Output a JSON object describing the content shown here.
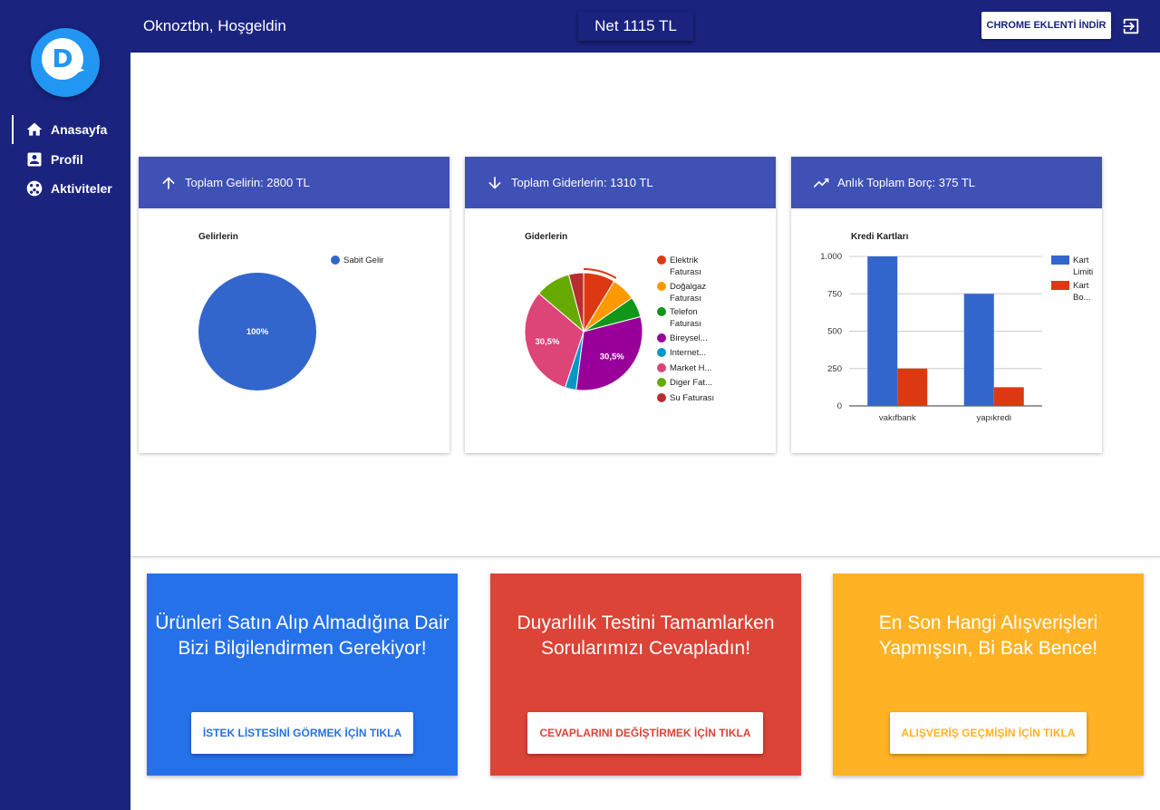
{
  "sidebar": {
    "logo_letter": "D",
    "items": [
      {
        "label": "Anasayfa",
        "icon": "home-icon",
        "active": true
      },
      {
        "label": "Profil",
        "icon": "profile-icon",
        "active": false
      },
      {
        "label": "Aktiviteler",
        "icon": "activities-icon",
        "active": false
      }
    ]
  },
  "header": {
    "welcome": "Oknoztbn, Hoşgeldin",
    "net": "Net 1115 TL",
    "chrome_button": "CHROME EKLENTİ İNDİR",
    "logout_icon": "logout-icon"
  },
  "colors": {
    "navy": "#1a237e",
    "card_header": "#3f51b5",
    "blue": "#2571e9",
    "red": "#db4437",
    "yellow": "#ffb224"
  },
  "cards": [
    {
      "title": "Toplam Gelirin: 2800 TL",
      "icon": "arrow-up-icon"
    },
    {
      "title": "Toplam Giderlerin: 1310 TL",
      "icon": "arrow-down-icon"
    },
    {
      "title": "Anlık Toplam Borç: 375 TL",
      "icon": "trending-up-icon"
    }
  ],
  "chart_data": [
    {
      "type": "pie",
      "title": "Gelirlerin",
      "slices": [
        {
          "label": "Sabit Gelir",
          "value": 100,
          "color": "#3366cc",
          "display": "100%"
        }
      ]
    },
    {
      "type": "pie",
      "title": "Giderlerin",
      "slices": [
        {
          "label": "Elektrik Faturası",
          "lines": [
            "Elektrik",
            "Faturası"
          ],
          "value": 8.5,
          "color": "#dc3912"
        },
        {
          "label": "Doğalgaz Faturası",
          "lines": [
            "Doğalgaz",
            "Faturası"
          ],
          "value": 6.5,
          "color": "#ff9900"
        },
        {
          "label": "Telefon Faturası",
          "lines": [
            "Telefon",
            "Faturası"
          ],
          "value": 5.5,
          "color": "#109618"
        },
        {
          "label": "Bireysel...",
          "lines": [
            "Bireysel..."
          ],
          "value": 30.5,
          "color": "#990099",
          "display": "30,5%"
        },
        {
          "label": "Internet...",
          "lines": [
            "Internet..."
          ],
          "value": 3,
          "color": "#0099c6"
        },
        {
          "label": "Market H...",
          "lines": [
            "Market H..."
          ],
          "value": 30.5,
          "color": "#dd4477",
          "display": "30,5%"
        },
        {
          "label": "Diger Fat...",
          "lines": [
            "Diger Fat..."
          ],
          "value": 9.5,
          "color": "#66aa00"
        },
        {
          "label": "Su Faturası",
          "lines": [
            "Su Faturası"
          ],
          "value": 4,
          "color": "#b82e2e"
        }
      ]
    },
    {
      "type": "bar",
      "title": "Kredi Kartları",
      "categories": [
        "vakıfbank",
        "yapıkredi"
      ],
      "series": [
        {
          "name": "Kart Limiti",
          "lines": [
            "Kart",
            "Limiti"
          ],
          "values": [
            1000,
            750
          ],
          "color": "#3366cc"
        },
        {
          "name": "Kart Bo...",
          "lines": [
            "Kart",
            "Bo..."
          ],
          "values": [
            250,
            125
          ],
          "color": "#dc3912"
        }
      ],
      "yticks": [
        "1.000",
        "750",
        "500",
        "250",
        "0"
      ],
      "ylim": [
        0,
        1000
      ]
    }
  ],
  "promos": [
    {
      "text": "Ürünleri Satın Alıp Almadığına Dair Bizi Bilgilendirmen Gerekiyor!",
      "lines": [
        "Ürünleri Satın Alıp Almadığına Dair",
        "Bizi Bilgilendirmen Gerekiyor!"
      ],
      "button": "İSTEK LİSTESİNİ GÖRMEK İÇİN TIKLA",
      "color": "#2571e9"
    },
    {
      "text": "Duyarlılık Testini Tamamlarken Sorularımızı Cevapladın!",
      "lines": [
        "Duyarlılık Testini Tamamlarken",
        "Sorularımızı Cevapladın!"
      ],
      "button": "CEVAPLARINI DEĞİŞTİRMEK İÇİN TIKLA",
      "color": "#db4437"
    },
    {
      "text": "En Son Hangi Alışverişleri Yapmışsın, Bi Bak Bence!",
      "lines": [
        "En Son Hangi Alışverişleri",
        "Yapmışsın, Bi Bak Bence!"
      ],
      "button": "ALIŞVERİŞ GEÇMİŞİN İÇİN TIKLA",
      "color": "#ffb224"
    }
  ]
}
